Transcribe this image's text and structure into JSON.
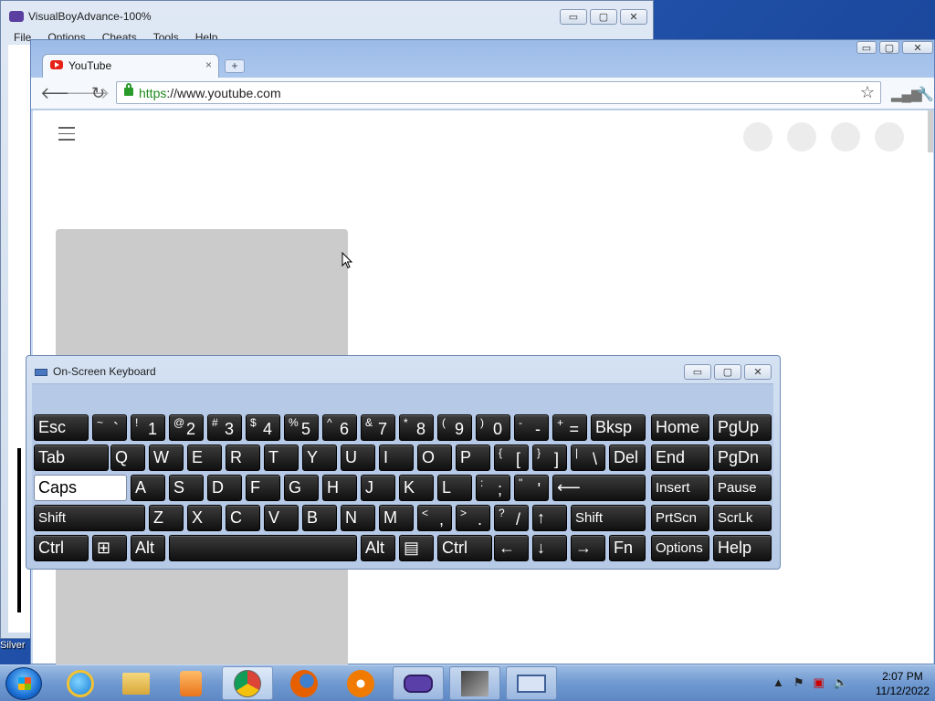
{
  "vba": {
    "title": "VisualBoyAdvance-100%",
    "menu": [
      "File",
      "Options",
      "Cheats",
      "Tools",
      "Help"
    ]
  },
  "chrome": {
    "tab_title": "YouTube",
    "tab_close": "×",
    "new_tab": "+",
    "url_scheme": "https",
    "url_rest": "://www.youtube.com"
  },
  "window_buttons": {
    "minimize": "▭",
    "maximize": "▢",
    "close": "✕"
  },
  "desktop_label": "Pok\nSilver",
  "osk": {
    "title": "On-Screen Keyboard",
    "rows": [
      [
        {
          "lab": "Esc"
        },
        {
          "sup": "~",
          "main": "`"
        },
        {
          "sup": "!",
          "main": "1"
        },
        {
          "sup": "@",
          "main": "2"
        },
        {
          "sup": "#",
          "main": "3"
        },
        {
          "sup": "$",
          "main": "4"
        },
        {
          "sup": "%",
          "main": "5"
        },
        {
          "sup": "^",
          "main": "6"
        },
        {
          "sup": "&",
          "main": "7"
        },
        {
          "sup": "*",
          "main": "8"
        },
        {
          "sup": "(",
          "main": "9"
        },
        {
          "sup": ")",
          "main": "0"
        },
        {
          "sup": "-",
          "main": "-"
        },
        {
          "sup": "+",
          "main": "="
        },
        {
          "lab": "Bksp"
        },
        {
          "lab": "Home"
        },
        {
          "lab": "PgUp"
        }
      ],
      [
        {
          "lab": "Tab"
        },
        {
          "lab": "Q"
        },
        {
          "lab": "W"
        },
        {
          "lab": "E"
        },
        {
          "lab": "R"
        },
        {
          "lab": "T"
        },
        {
          "lab": "Y"
        },
        {
          "lab": "U"
        },
        {
          "lab": "I"
        },
        {
          "lab": "O"
        },
        {
          "lab": "P"
        },
        {
          "sup": "{",
          "main": "["
        },
        {
          "sup": "}",
          "main": "]"
        },
        {
          "sup": "|",
          "main": "\\"
        },
        {
          "lab": "Del"
        },
        {
          "lab": "End"
        },
        {
          "lab": "PgDn"
        }
      ],
      [
        {
          "lab": "Caps"
        },
        {
          "lab": "A"
        },
        {
          "lab": "S"
        },
        {
          "lab": "D"
        },
        {
          "lab": "F"
        },
        {
          "lab": "G"
        },
        {
          "lab": "H"
        },
        {
          "lab": "J"
        },
        {
          "lab": "K"
        },
        {
          "lab": "L"
        },
        {
          "sup": ":",
          "main": ";"
        },
        {
          "sup": "\"",
          "main": "'"
        },
        {
          "lab": "⟵"
        },
        {
          "lab": "Insert"
        },
        {
          "lab": "Pause"
        }
      ],
      [
        {
          "lab": "Shift"
        },
        {
          "lab": "Z"
        },
        {
          "lab": "X"
        },
        {
          "lab": "C"
        },
        {
          "lab": "V"
        },
        {
          "lab": "B"
        },
        {
          "lab": "N"
        },
        {
          "lab": "M"
        },
        {
          "sup": "<",
          "main": ","
        },
        {
          "sup": ">",
          "main": "."
        },
        {
          "sup": "?",
          "main": "/"
        },
        {
          "lab": "↑"
        },
        {
          "lab": "Shift"
        },
        {
          "lab": "PrtScn"
        },
        {
          "lab": "ScrLk"
        }
      ],
      [
        {
          "lab": "Ctrl"
        },
        {
          "lab": "⊞"
        },
        {
          "lab": "Alt"
        },
        {
          "lab": ""
        },
        {
          "lab": "Alt"
        },
        {
          "lab": "▤"
        },
        {
          "lab": "Ctrl"
        },
        {
          "lab": "←"
        },
        {
          "lab": "↓"
        },
        {
          "lab": "→"
        },
        {
          "lab": "Fn"
        },
        {
          "lab": "Options"
        },
        {
          "lab": "Help"
        }
      ]
    ]
  },
  "clock": {
    "time": "2:07 PM",
    "date": "11/12/2022"
  }
}
